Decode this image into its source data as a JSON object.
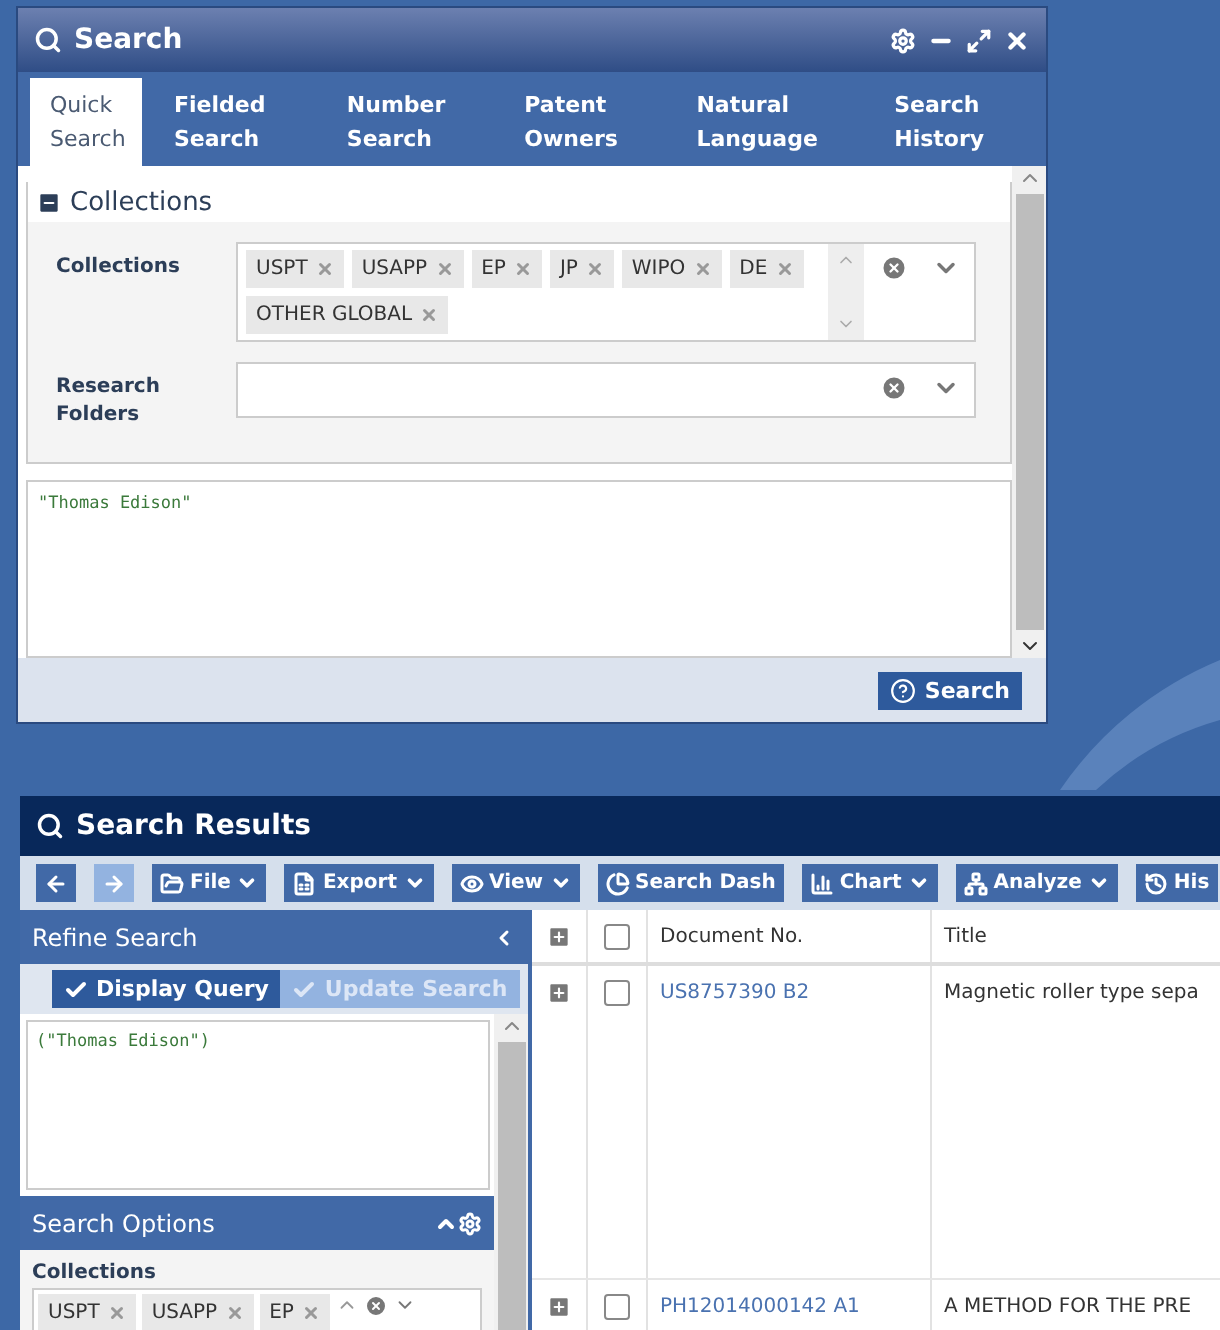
{
  "search_window": {
    "title": "Search",
    "tabs": [
      {
        "label": "Quick Search",
        "selected": true
      },
      {
        "label": "Fielded Search",
        "selected": false
      },
      {
        "label": "Number Search",
        "selected": false
      },
      {
        "label": "Patent Owners",
        "selected": false
      },
      {
        "label": "Natural Language",
        "selected": false
      },
      {
        "label": "Search History",
        "selected": false
      }
    ],
    "section": {
      "title": "Collections",
      "expanded": true
    },
    "fields": [
      {
        "label": "Collections",
        "tags": [
          "USPT",
          "USAPP",
          "EP",
          "JP",
          "WIPO",
          "DE",
          "OTHER GLOBAL"
        ]
      },
      {
        "label": "Research Folders"
      }
    ],
    "query": "\"Thomas Edison\"",
    "button": "Search"
  },
  "results_window": {
    "title": "Search Results",
    "toolbar": [
      {
        "kind": "icon",
        "disabled": false
      },
      {
        "kind": "icon",
        "disabled": true
      },
      {
        "kind": "menu",
        "label": "File",
        "disabled": false
      },
      {
        "kind": "menu",
        "label": "Export",
        "disabled": false
      },
      {
        "kind": "menu",
        "label": "View",
        "disabled": false
      },
      {
        "kind": "button",
        "label": "Search Dash",
        "disabled": false
      },
      {
        "kind": "menu",
        "label": "Chart",
        "disabled": false
      },
      {
        "kind": "menu",
        "label": "Analyze",
        "disabled": false
      },
      {
        "kind": "button",
        "label": "His",
        "disabled": false
      }
    ],
    "refine": {
      "title": "Refine Search",
      "buttons": [
        {
          "label": "Display Query",
          "disabled": false
        },
        {
          "label": "Update Search",
          "disabled": true
        }
      ],
      "query": "(\"Thomas Edison\")"
    },
    "options": {
      "title": "Search Options",
      "collections_label": "Collections",
      "tags": [
        "USPT",
        "USAPP",
        "EP"
      ]
    },
    "table": {
      "select_all_checked": false,
      "columns": [
        "Document No.",
        "Title"
      ],
      "rows": [
        {
          "document": "US8757390 B2",
          "title": "Magnetic roller type sepa",
          "checked": false
        },
        {
          "document": "PH12014000142 A1",
          "title": "A METHOD FOR THE PRE",
          "checked": false
        }
      ]
    }
  }
}
